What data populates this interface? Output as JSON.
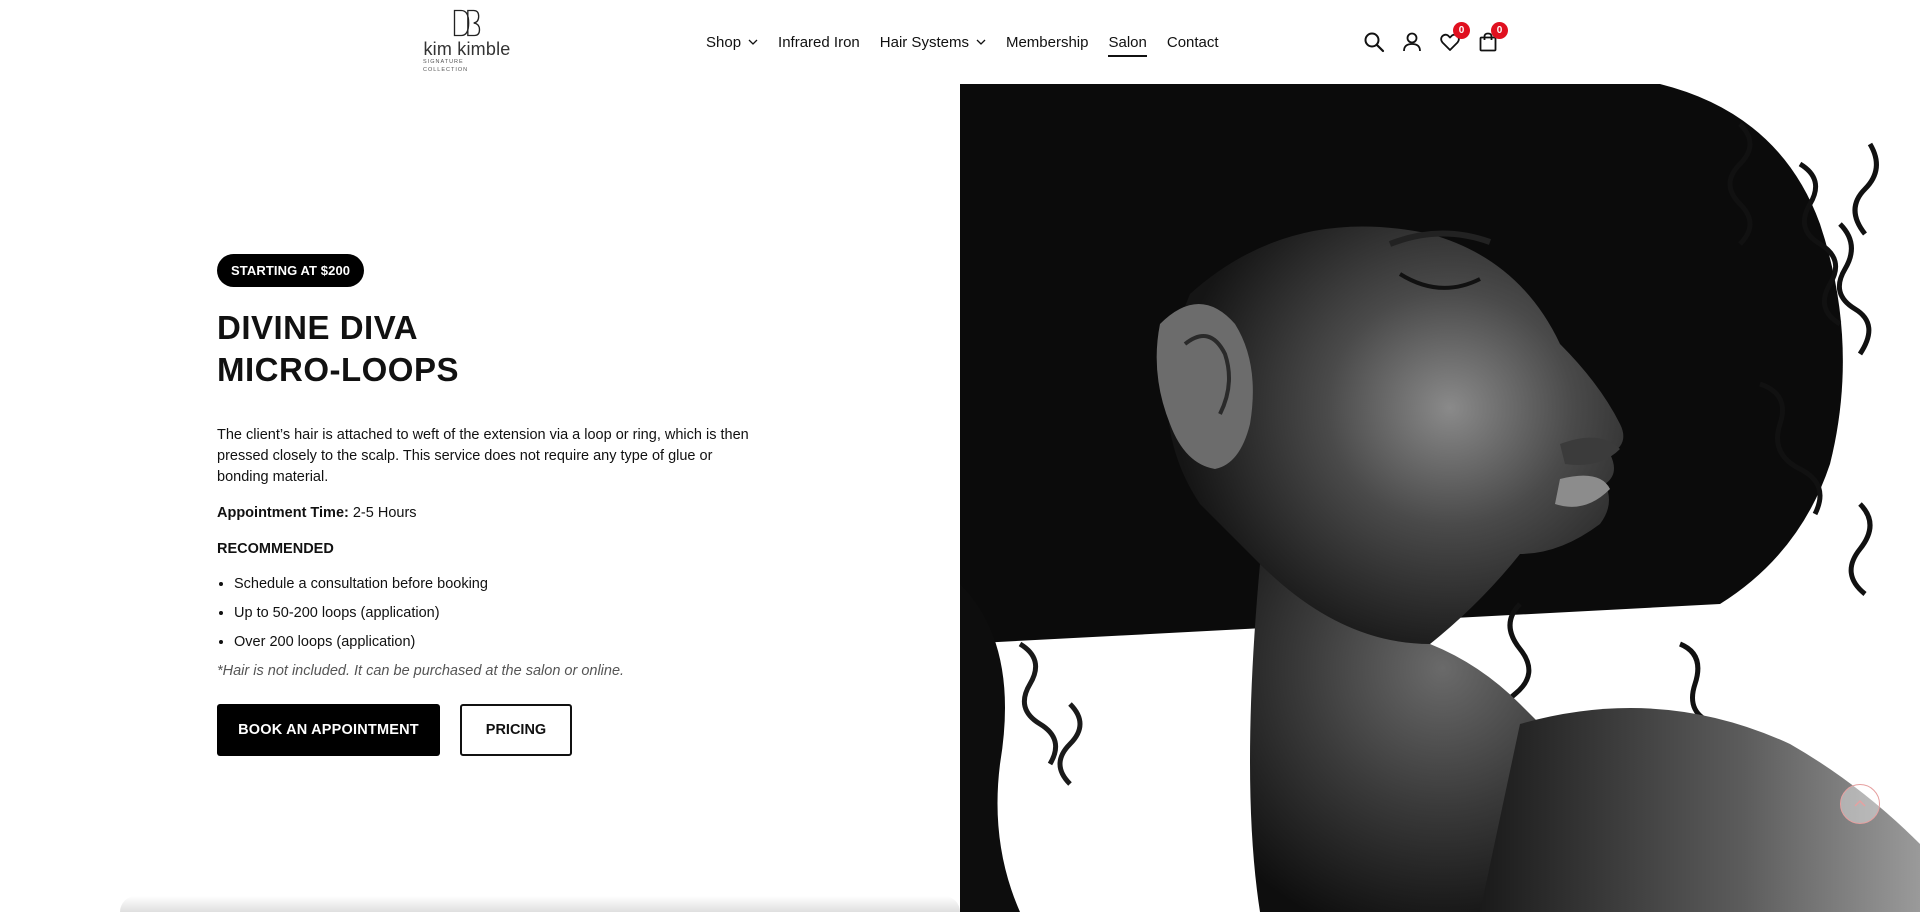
{
  "brand": {
    "logo_text": "kim kimble",
    "logo_subtext": "SIGNATURE COLLECTION"
  },
  "nav": {
    "items": [
      {
        "label": "Shop",
        "has_dropdown": true
      },
      {
        "label": "Infrared Iron",
        "has_dropdown": false
      },
      {
        "label": "Hair Systems",
        "has_dropdown": true
      },
      {
        "label": "Membership",
        "has_dropdown": false
      },
      {
        "label": "Salon",
        "has_dropdown": false,
        "active": true
      },
      {
        "label": "Contact",
        "has_dropdown": false
      }
    ]
  },
  "header_icons": {
    "search": "search-icon",
    "account": "user-icon",
    "wishlist": {
      "icon": "heart-icon",
      "count": "0"
    },
    "cart": {
      "icon": "bag-icon",
      "count": "0"
    }
  },
  "service": {
    "price_badge": "STARTING AT $200",
    "title_line1": "DIVINE DIVA",
    "title_line2": "MICRO-LOOPS",
    "description": "The client’s hair is attached to weft of the extension via a loop or ring, which is then pressed closely to the scalp. This service does not require any type of glue or bonding material.",
    "appointment_label": "Appointment Time:",
    "appointment_value": " 2-5 Hours",
    "recommended_heading": "RECOMMENDED",
    "recommended_items": [
      "Schedule a consultation before booking",
      "Up to 50-200 loops (application)",
      "Over 200 loops (application)"
    ],
    "note": "*Hair is not included. It can be purchased at the salon or online.",
    "book_button": "BOOK AN APPOINTMENT",
    "pricing_button": "PRICING"
  },
  "colors": {
    "accent": "#000000",
    "badge": "#e0101f",
    "scroll_top_border": "#e6a0a0"
  }
}
